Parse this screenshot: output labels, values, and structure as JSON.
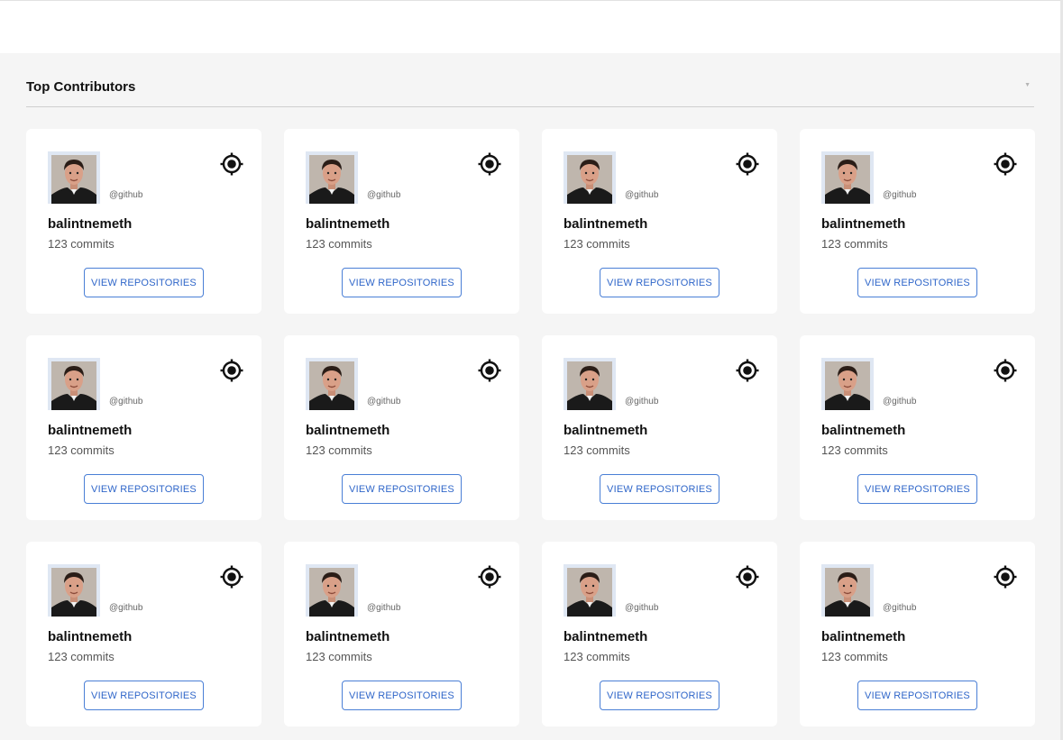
{
  "section": {
    "title": "Top Contributors"
  },
  "colors": {
    "accent": "#2f66c9",
    "card_background": "#ffffff",
    "page_background": "#f5f5f5"
  },
  "contributors": [
    {
      "username": "balintnemeth",
      "handle": "@github",
      "commits": "123 commits",
      "button_label": "VIEW REPOSITORIES",
      "icon": "target-icon"
    },
    {
      "username": "balintnemeth",
      "handle": "@github",
      "commits": "123 commits",
      "button_label": "VIEW REPOSITORIES",
      "icon": "target-icon"
    },
    {
      "username": "balintnemeth",
      "handle": "@github",
      "commits": "123 commits",
      "button_label": "VIEW REPOSITORIES",
      "icon": "target-icon"
    },
    {
      "username": "balintnemeth",
      "handle": "@github",
      "commits": "123 commits",
      "button_label": "VIEW REPOSITORIES",
      "icon": "target-icon"
    },
    {
      "username": "balintnemeth",
      "handle": "@github",
      "commits": "123 commits",
      "button_label": "VIEW REPOSITORIES",
      "icon": "target-icon"
    },
    {
      "username": "balintnemeth",
      "handle": "@github",
      "commits": "123 commits",
      "button_label": "VIEW REPOSITORIES",
      "icon": "target-icon"
    },
    {
      "username": "balintnemeth",
      "handle": "@github",
      "commits": "123 commits",
      "button_label": "VIEW REPOSITORIES",
      "icon": "target-icon"
    },
    {
      "username": "balintnemeth",
      "handle": "@github",
      "commits": "123 commits",
      "button_label": "VIEW REPOSITORIES",
      "icon": "target-icon"
    },
    {
      "username": "balintnemeth",
      "handle": "@github",
      "commits": "123 commits",
      "button_label": "VIEW REPOSITORIES",
      "icon": "target-icon"
    },
    {
      "username": "balintnemeth",
      "handle": "@github",
      "commits": "123 commits",
      "button_label": "VIEW REPOSITORIES",
      "icon": "target-icon"
    },
    {
      "username": "balintnemeth",
      "handle": "@github",
      "commits": "123 commits",
      "button_label": "VIEW REPOSITORIES",
      "icon": "target-icon"
    },
    {
      "username": "balintnemeth",
      "handle": "@github",
      "commits": "123 commits",
      "button_label": "VIEW REPOSITORIES",
      "icon": "target-icon"
    }
  ]
}
